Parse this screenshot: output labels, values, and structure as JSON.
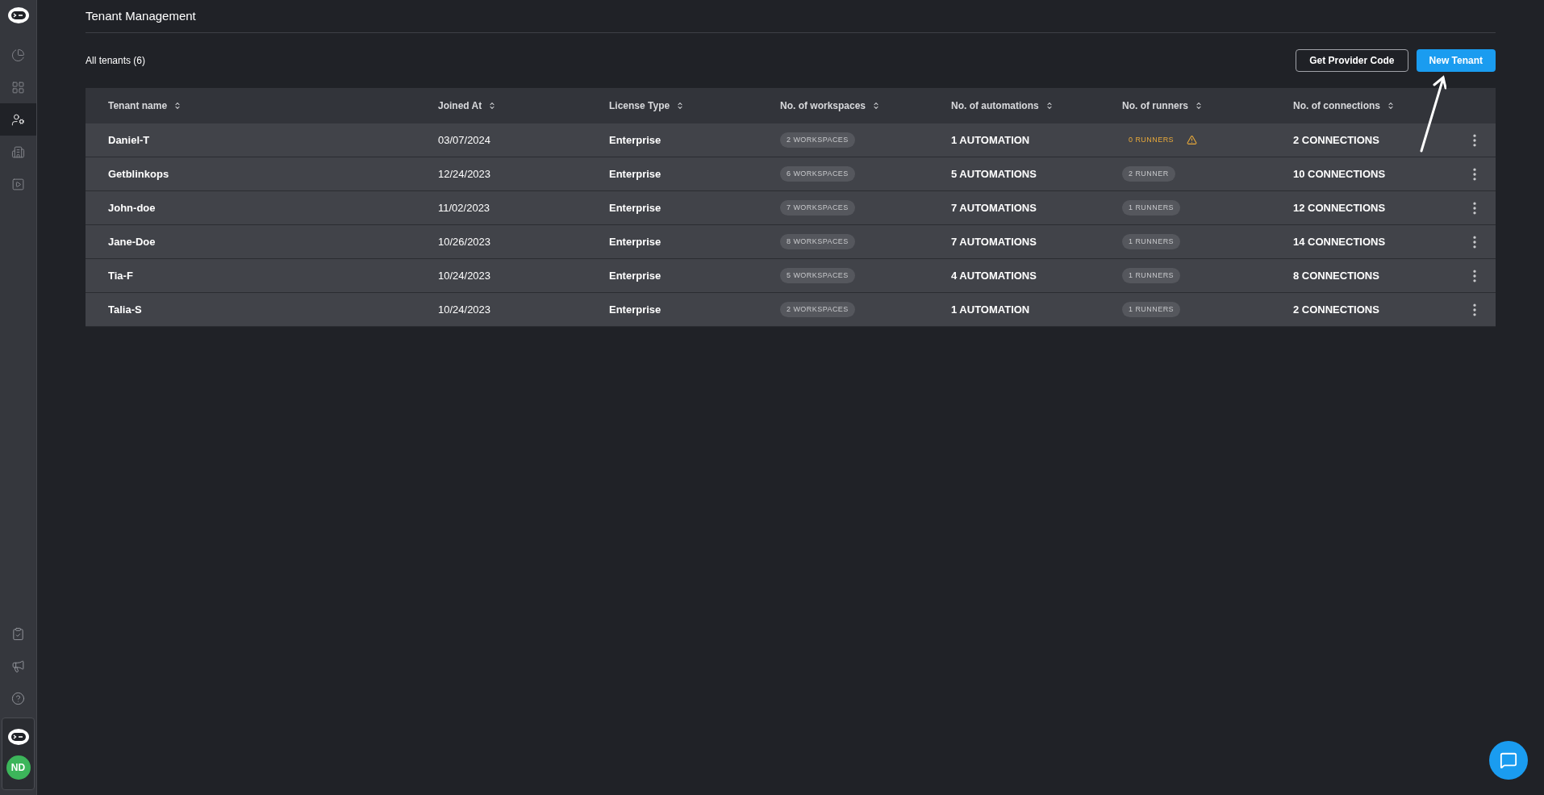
{
  "sidebar": {
    "items": [
      {
        "kind": "chart",
        "selected": false
      },
      {
        "kind": "grid",
        "selected": false
      },
      {
        "kind": "users",
        "selected": true
      },
      {
        "kind": "building",
        "selected": false
      },
      {
        "kind": "play",
        "selected": false
      }
    ],
    "bottom_items": [
      {
        "kind": "checklist"
      },
      {
        "kind": "megaphone"
      },
      {
        "kind": "help"
      }
    ],
    "avatar": "ND"
  },
  "page_title": "Tenant Management",
  "count_label": "All tenants (6)",
  "buttons": [
    {
      "label": "Get Provider Code",
      "kind": "outline"
    },
    {
      "label": "New Tenant",
      "kind": "primary"
    }
  ],
  "table": {
    "columns": [
      "Tenant name",
      "Joined At",
      "License Type",
      "No. of workspaces",
      "No. of automations",
      "No. of runners",
      "No. of connections"
    ],
    "rows": [
      {
        "name": "Daniel-T",
        "joined": "03/07/2024",
        "license": "Enterprise",
        "workspaces": "2 WORKSPACES",
        "automations": "1 AUTOMATION",
        "runners": "0 RUNNERS",
        "runners_warning": true,
        "connections": "2 CONNECTIONS"
      },
      {
        "name": "Getblinkops",
        "joined": "12/24/2023",
        "license": "Enterprise",
        "workspaces": "6 WORKSPACES",
        "automations": "5 AUTOMATIONS",
        "runners": "2 RUNNER",
        "runners_warning": false,
        "connections": "10 CONNECTIONS"
      },
      {
        "name": "John-doe",
        "joined": "11/02/2023",
        "license": "Enterprise",
        "workspaces": "7 WORKSPACES",
        "automations": "7 AUTOMATIONS",
        "runners": "1 RUNNERS",
        "runners_warning": false,
        "connections": "12 CONNECTIONS"
      },
      {
        "name": "Jane-Doe",
        "joined": "10/26/2023",
        "license": "Enterprise",
        "workspaces": "8 WORKSPACES",
        "automations": "7 AUTOMATIONS",
        "runners": "1 RUNNERS",
        "runners_warning": false,
        "connections": "14 CONNECTIONS"
      },
      {
        "name": "Tia-F",
        "joined": "10/24/2023",
        "license": "Enterprise",
        "workspaces": "5 WORKSPACES",
        "automations": "4 AUTOMATIONS",
        "runners": "1 RUNNERS",
        "runners_warning": false,
        "connections": "8 CONNECTIONS"
      },
      {
        "name": "Talia-S",
        "joined": "10/24/2023",
        "license": "Enterprise",
        "workspaces": "2 WORKSPACES",
        "automations": "1 AUTOMATION",
        "runners": "1 RUNNERS",
        "runners_warning": false,
        "connections": "2 CONNECTIONS"
      }
    ]
  }
}
